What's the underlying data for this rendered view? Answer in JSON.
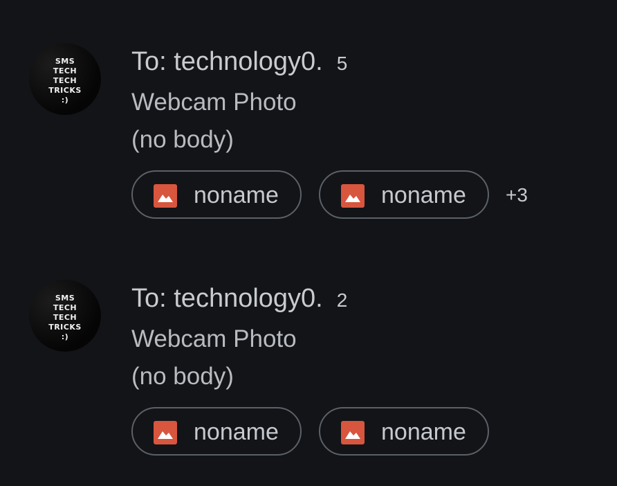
{
  "threads": [
    {
      "avatar_text": [
        "SMS",
        "TECH",
        "TECH",
        "TRICKS",
        ":)"
      ],
      "recipient": "To: technology0.",
      "count": "5",
      "subject": "Webcam Photo",
      "snippet": "(no body)",
      "attachments": [
        {
          "icon": "image-icon",
          "name": "noname"
        },
        {
          "icon": "image-icon",
          "name": "noname"
        }
      ],
      "more_attachments": "+3"
    },
    {
      "avatar_text": [
        "SMS",
        "TECH",
        "TECH",
        "TRICKS",
        ":)"
      ],
      "recipient": "To: technology0.",
      "count": "2",
      "subject": "Webcam Photo",
      "snippet": "(no body)",
      "attachments": [
        {
          "icon": "image-icon",
          "name": "noname"
        },
        {
          "icon": "image-icon",
          "name": "noname"
        }
      ]
    }
  ],
  "colors": {
    "background": "#121418",
    "chip_border": "#5c6168",
    "image_icon": "#d8553e",
    "text": "#c9cbcf"
  }
}
